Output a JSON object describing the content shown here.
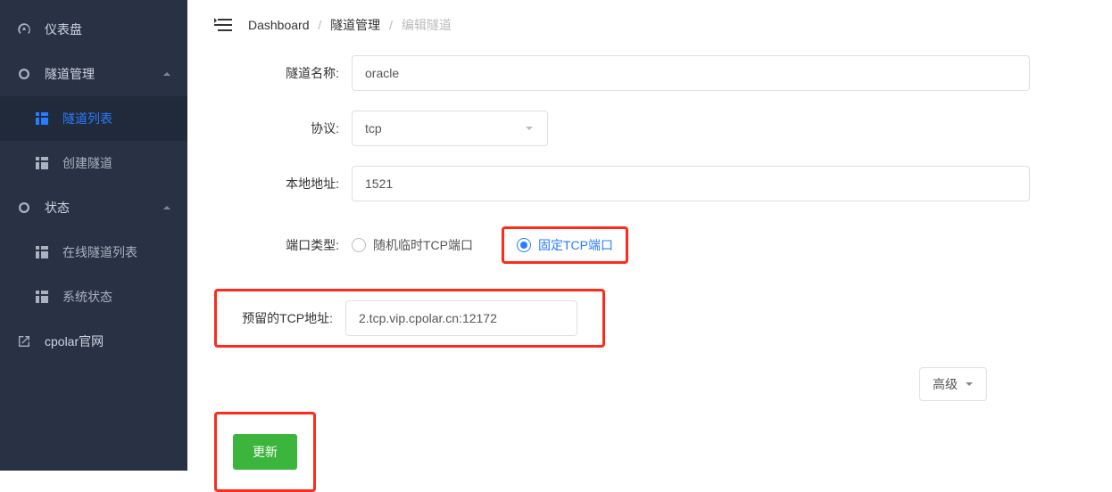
{
  "sidebar": {
    "dashboard": {
      "label": "仪表盘"
    },
    "tunnel": {
      "label": "隧道管理",
      "expanded": true,
      "sub": {
        "list": "隧道列表",
        "create": "创建隧道"
      }
    },
    "status": {
      "label": "状态",
      "expanded": true,
      "sub": {
        "online": "在线隧道列表",
        "sys": "系统状态"
      }
    },
    "site": {
      "label": "cpolar官网"
    }
  },
  "breadcrumb": {
    "root": "Dashboard",
    "section": "隧道管理",
    "current": "编辑隧道"
  },
  "form": {
    "name": {
      "label": "隧道名称:",
      "value": "oracle"
    },
    "protocol": {
      "label": "协议:",
      "value": "tcp"
    },
    "localaddr": {
      "label": "本地地址:",
      "value": "1521"
    },
    "porttype": {
      "label": "端口类型:",
      "opts": {
        "random": "随机临时TCP端口",
        "fixed": "固定TCP端口"
      },
      "selected": "fixed"
    },
    "reserved": {
      "label": "预留的TCP地址:",
      "value": "2.tcp.vip.cpolar.cn:12172"
    },
    "advanced": {
      "label": "高级"
    },
    "submit": {
      "label": "更新"
    }
  }
}
